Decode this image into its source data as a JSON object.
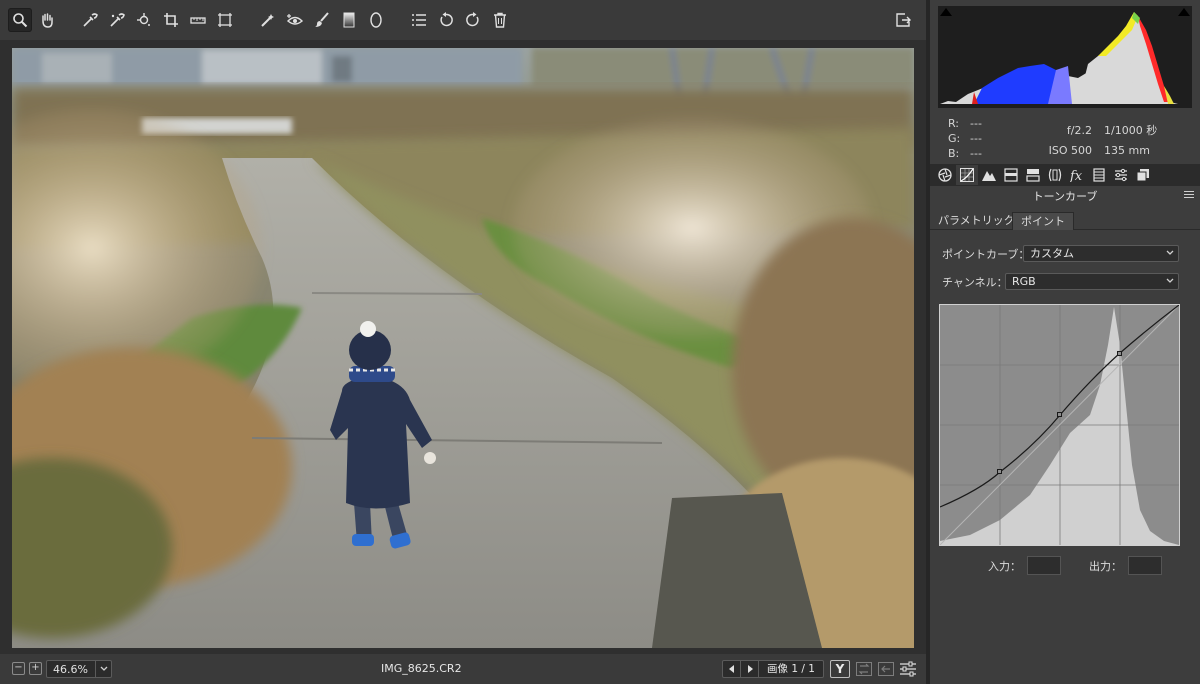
{
  "toolbar": {
    "tools": [
      "zoom-tool",
      "hand-tool",
      "white-balance-tool",
      "color-sampler-tool",
      "target-adjustment-tool",
      "crop-tool",
      "straighten-tool",
      "transform-tool",
      "spot-removal-tool",
      "red-eye-tool",
      "adjustment-brush-tool",
      "graduated-filter-tool",
      "radial-filter-tool",
      "preferences-tool",
      "rotate-left-tool",
      "rotate-right-tool",
      "delete-tool"
    ]
  },
  "status": {
    "zoom": "46.6%",
    "filename": "IMG_8625.CR2",
    "image_count": "画像 1 / 1",
    "y_label": "Y"
  },
  "info": {
    "r_label": "R:",
    "r_value": "---",
    "g_label": "G:",
    "g_value": "---",
    "b_label": "B:",
    "b_value": "---",
    "aperture": "f/2.2",
    "shutter": "1/1000 秒",
    "iso": "ISO 500",
    "focal": "135 mm"
  },
  "panel": {
    "section_title": "トーンカーブ",
    "subtabs": [
      "パラメトリック",
      "ポイント"
    ],
    "active_subtab": "ポイント",
    "point_curve_label": "ポイントカーブ：",
    "point_curve_value": "カスタム",
    "channel_label": "チャンネル：",
    "channel_value": "RGB",
    "input_label": "入力：",
    "output_label": "出力：",
    "input_value": "",
    "output_value": ""
  },
  "colors": {
    "panel_bg": "#3d3d3d",
    "curve_bg": "#8c8c8c",
    "histogram_bg": "#1e1e1e"
  }
}
